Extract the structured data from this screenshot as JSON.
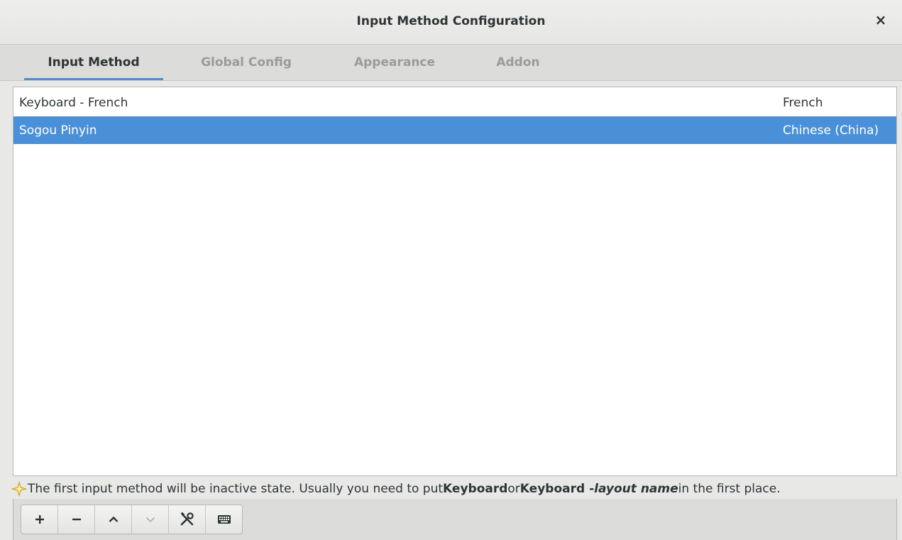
{
  "window": {
    "title": "Input Method Configuration",
    "close_label": "×"
  },
  "tabs": [
    {
      "label": "Input Method",
      "active": true
    },
    {
      "label": "Global Config",
      "active": false
    },
    {
      "label": "Appearance",
      "active": false
    },
    {
      "label": "Addon",
      "active": false
    }
  ],
  "input_methods": [
    {
      "name": "Keyboard - French",
      "language": "French",
      "selected": false
    },
    {
      "name": "Sogou Pinyin",
      "language": "Chinese (China)",
      "selected": true
    }
  ],
  "hint": {
    "text_before": "The first input method will be inactive state. Usually you need to put ",
    "bold1": "Keyboard",
    "text_mid": " or ",
    "bold2": "Keyboard - ",
    "italic": "layout name",
    "text_after": " in the first place."
  },
  "toolbar": [
    {
      "name": "add-button",
      "icon": "plus-icon"
    },
    {
      "name": "remove-button",
      "icon": "minus-icon"
    },
    {
      "name": "move-up-button",
      "icon": "chevron-up-icon"
    },
    {
      "name": "move-down-button",
      "icon": "chevron-down-icon"
    },
    {
      "name": "configure-button",
      "icon": "tools-icon"
    },
    {
      "name": "keyboard-layout-button",
      "icon": "keyboard-icon"
    }
  ],
  "colors": {
    "accent": "#4a90d9",
    "selected_text": "#ffffff",
    "inactive_tab": "#9a9c98",
    "hint_star": "#f5c242"
  }
}
